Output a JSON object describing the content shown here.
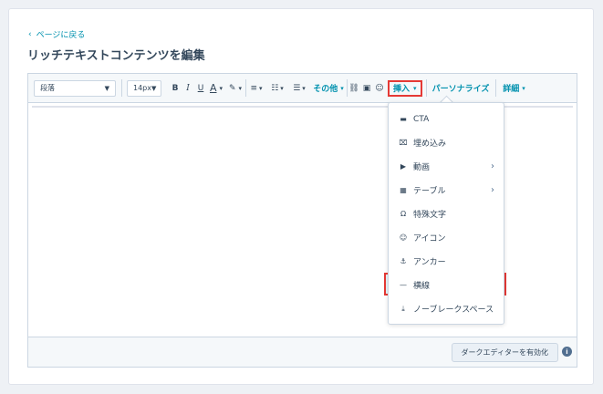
{
  "back_link": {
    "label": "ページに戻る",
    "icon": "chevron-left-icon"
  },
  "page_title": "リッチテキストコンテンツを編集",
  "toolbar": {
    "paragraph_value": "段落",
    "font_size_value": "14px",
    "bold": "B",
    "italic": "I",
    "underline": "U",
    "text_color": "A",
    "more_label": "その他",
    "insert_label": "挿入",
    "personalize_label": "パーソナライズ",
    "details_label": "詳細"
  },
  "dropdown": {
    "items": [
      {
        "label": "CTA",
        "icon": "cta-icon"
      },
      {
        "label": "埋め込み",
        "icon": "embed-icon"
      },
      {
        "label": "動画",
        "icon": "video-icon",
        "submenu": true
      },
      {
        "label": "テーブル",
        "icon": "table-icon",
        "submenu": true
      },
      {
        "label": "特殊文字",
        "icon": "special-char-icon"
      },
      {
        "label": "アイコン",
        "icon": "emoji-icon"
      },
      {
        "label": "アンカー",
        "icon": "anchor-icon"
      },
      {
        "label": "横線",
        "icon": "horizontal-rule-icon"
      },
      {
        "label": "ノーブレークスペース",
        "icon": "nbsp-icon"
      }
    ]
  },
  "footer": {
    "dark_editor_button": "ダークエディターを有効化",
    "info": "i"
  },
  "colors": {
    "accent": "#0091ae",
    "highlight": "#e53935",
    "text": "#33475b"
  }
}
